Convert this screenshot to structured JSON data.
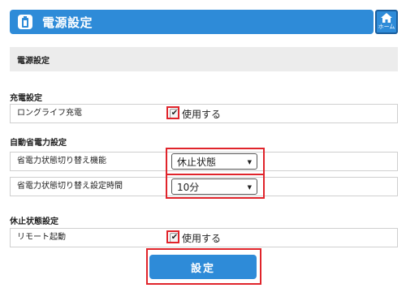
{
  "header": {
    "title": "電源設定",
    "icon": "battery-icon",
    "home_label": "ホーム",
    "home_icon": "home-icon"
  },
  "banner": {
    "text": "電源設定"
  },
  "sections": {
    "charge": {
      "title": "充電設定",
      "long_life": {
        "label": "ロングライフ充電",
        "checkbox_label": "使用する",
        "checked": true
      }
    },
    "auto_power": {
      "title": "自動省電力設定",
      "mode": {
        "label": "省電力状態切り替え機能",
        "value": "休止状態"
      },
      "time": {
        "label": "省電力状態切り替え設定時間",
        "value": "10分"
      }
    },
    "sleep": {
      "title": "休止状態設定",
      "remote": {
        "label": "リモート起動",
        "checkbox_label": "使用する",
        "checked": true
      }
    }
  },
  "submit_label": "設定",
  "colors": {
    "accent": "#2e8bd8",
    "highlight": "#e0242b"
  }
}
